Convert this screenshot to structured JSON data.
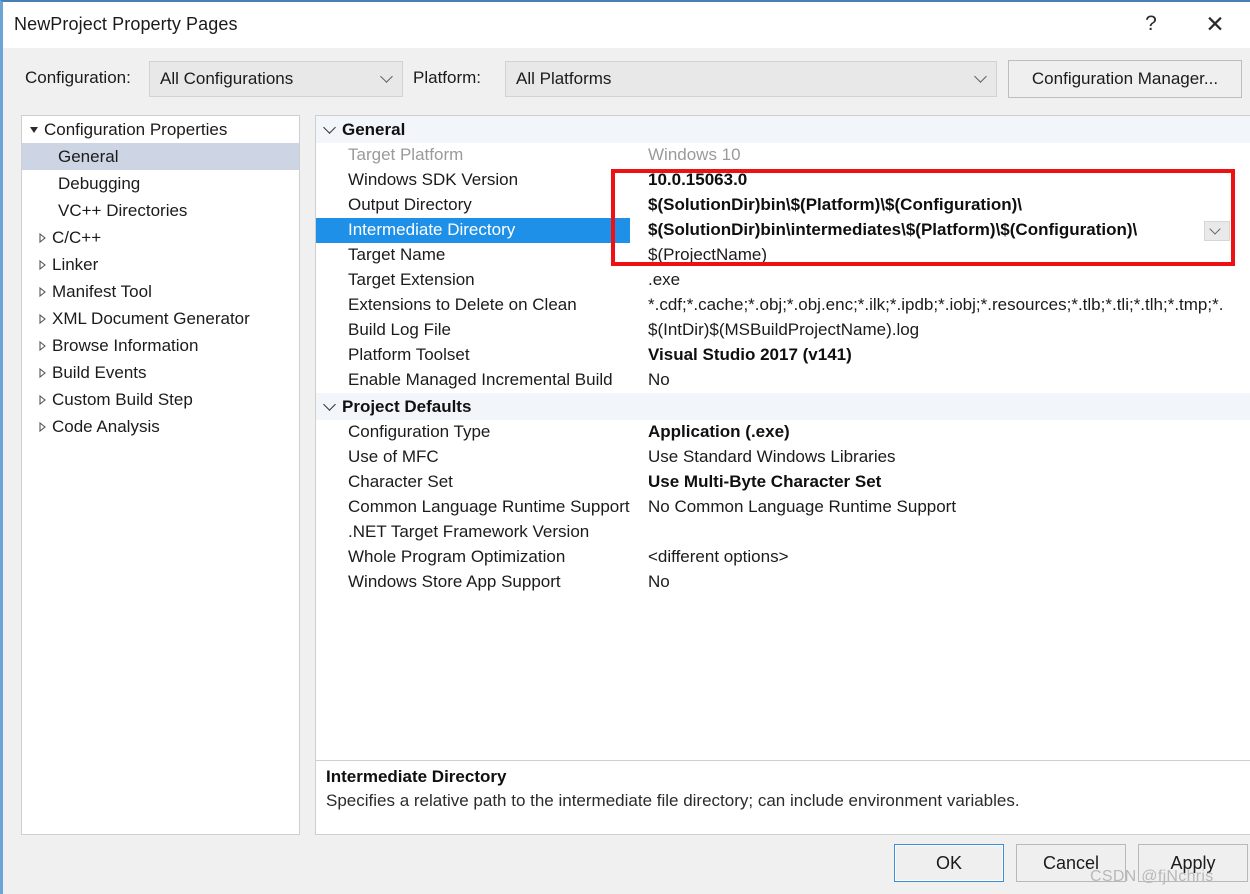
{
  "window": {
    "title": "NewProject Property Pages",
    "help_icon": "?",
    "close_icon": "✕"
  },
  "configbar": {
    "configuration_label": "Configuration:",
    "configuration_value": "All Configurations",
    "platform_label": "Platform:",
    "platform_value": "All Platforms",
    "configuration_manager_button": "Configuration Manager..."
  },
  "tree": {
    "items": [
      {
        "label": "Configuration Properties",
        "level": "root",
        "expander": "down",
        "selected": false
      },
      {
        "label": "General",
        "level": "leaf",
        "expander": "none",
        "selected": true
      },
      {
        "label": "Debugging",
        "level": "leaf",
        "expander": "none",
        "selected": false
      },
      {
        "label": "VC++ Directories",
        "level": "leaf",
        "expander": "none",
        "selected": false
      },
      {
        "label": "C/C++",
        "level": "expandable",
        "expander": "right",
        "selected": false
      },
      {
        "label": "Linker",
        "level": "expandable",
        "expander": "right",
        "selected": false
      },
      {
        "label": "Manifest Tool",
        "level": "expandable",
        "expander": "right",
        "selected": false
      },
      {
        "label": "XML Document Generator",
        "level": "expandable",
        "expander": "right",
        "selected": false
      },
      {
        "label": "Browse Information",
        "level": "expandable",
        "expander": "right",
        "selected": false
      },
      {
        "label": "Build Events",
        "level": "expandable",
        "expander": "right",
        "selected": false
      },
      {
        "label": "Custom Build Step",
        "level": "expandable",
        "expander": "right",
        "selected": false
      },
      {
        "label": "Code Analysis",
        "level": "expandable",
        "expander": "right",
        "selected": false
      }
    ]
  },
  "grid": {
    "sections": [
      {
        "title": "General",
        "rows": [
          {
            "name": "Target Platform",
            "value": "Windows 10",
            "style": "dim"
          },
          {
            "name": "Windows SDK Version",
            "value": "10.0.15063.0",
            "style": "boldval"
          },
          {
            "name": "Output Directory",
            "value": "$(SolutionDir)bin\\$(Platform)\\$(Configuration)\\",
            "style": "boldval"
          },
          {
            "name": "Intermediate Directory",
            "value": "$(SolutionDir)bin\\intermediates\\$(Platform)\\$(Configuration)\\",
            "style": "selected"
          },
          {
            "name": "Target Name",
            "value": "$(ProjectName)",
            "style": "normal"
          },
          {
            "name": "Target Extension",
            "value": ".exe",
            "style": "normal"
          },
          {
            "name": "Extensions to Delete on Clean",
            "value": "*.cdf;*.cache;*.obj;*.obj.enc;*.ilk;*.ipdb;*.iobj;*.resources;*.tlb;*.tli;*.tlh;*.tmp;*.",
            "style": "normal"
          },
          {
            "name": "Build Log File",
            "value": "$(IntDir)$(MSBuildProjectName).log",
            "style": "normal"
          },
          {
            "name": "Platform Toolset",
            "value": "Visual Studio 2017 (v141)",
            "style": "boldval"
          },
          {
            "name": "Enable Managed Incremental Build",
            "value": "No",
            "style": "normal"
          }
        ]
      },
      {
        "title": "Project Defaults",
        "rows": [
          {
            "name": "Configuration Type",
            "value": "Application (.exe)",
            "style": "boldval"
          },
          {
            "name": "Use of MFC",
            "value": "Use Standard Windows Libraries",
            "style": "normal"
          },
          {
            "name": "Character Set",
            "value": "Use Multi-Byte Character Set",
            "style": "boldval"
          },
          {
            "name": "Common Language Runtime Support",
            "value": "No Common Language Runtime Support",
            "style": "normal"
          },
          {
            "name": ".NET Target Framework Version",
            "value": "",
            "style": "normal"
          },
          {
            "name": "Whole Program Optimization",
            "value": "<different options>",
            "style": "normal"
          },
          {
            "name": "Windows Store App Support",
            "value": "No",
            "style": "normal"
          }
        ]
      }
    ]
  },
  "description": {
    "title": "Intermediate Directory",
    "text": "Specifies a relative path to the intermediate file directory; can include environment variables."
  },
  "footer": {
    "ok": "OK",
    "cancel": "Cancel",
    "apply": "Apply"
  },
  "watermark": "CSDN @fjNchris",
  "colors": {
    "selection_blue": "#1e90e8",
    "tree_selection": "#cdd4e4",
    "annotation_red": "#ee1111",
    "section_header_bg": "#f2f5fa",
    "dialog_bg": "#f0f0f0"
  }
}
